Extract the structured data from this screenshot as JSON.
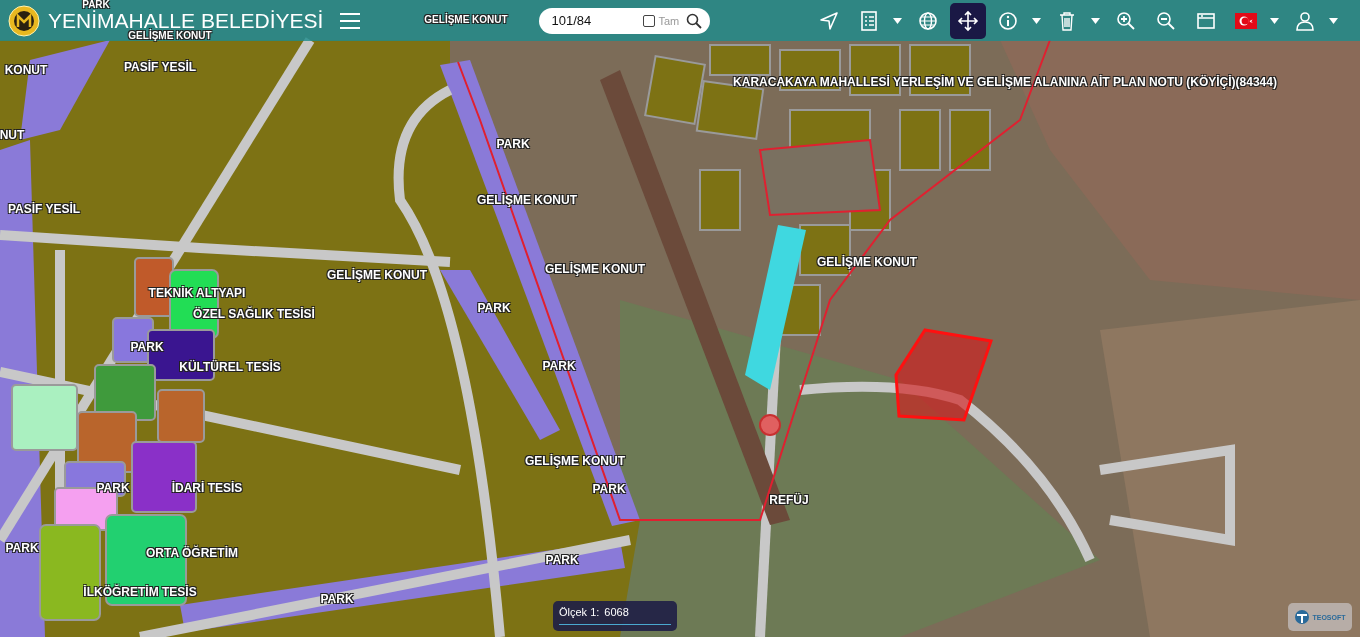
{
  "header": {
    "title": "YENİMAHALLE BELEDİYESİ"
  },
  "search": {
    "value": "101/84",
    "exact": {
      "label": "Tam",
      "checked": false
    }
  },
  "toolbar": [
    {
      "selected": false,
      "dropdown": false
    },
    {
      "selected": false,
      "dropdown": true
    },
    {
      "selected": false,
      "dropdown": false
    },
    {
      "selected": true,
      "dropdown": false
    },
    {
      "selected": false,
      "dropdown": true
    },
    {
      "selected": false,
      "dropdown": true
    },
    {
      "selected": false,
      "dropdown": false
    },
    {
      "selected": false,
      "dropdown": false
    },
    {
      "selected": false,
      "dropdown": false
    },
    {
      "selected": false,
      "dropdown": true
    },
    {
      "selected": false,
      "dropdown": true
    }
  ],
  "map_labels": [
    "PARK",
    "GELİŞME KONUT",
    "GELİŞME KONUT",
    "KONUT",
    "PASİF YESİL",
    "NUT",
    "PASİF YESİL",
    "PARK",
    "GELİŞME KONUT",
    "GELİŞME KONUT",
    "GELİŞME KONUT",
    "GELİŞME KONUT",
    "KARACAKAYA MAHALLESİ YERLEŞİM VE GELİŞME ALANINA AİT PLAN NOTU (KÖYİÇİ)(84344)",
    "TEKNİK ALTYAPI",
    "ÖZEL SAĞLIK TESİSİ",
    "PARK",
    "PARK",
    "KÜLTÜREL TESİS",
    "PARK",
    "GELİŞME KONUT",
    "PARK",
    "İDARİ TESİS",
    "PARK",
    "REFÜJ",
    "PARK",
    "ORTA ÖĞRETİM",
    "PARK",
    "İLKÖĞRETİM TESİS",
    "PARK"
  ],
  "scale": {
    "label": "Ölçek 1:",
    "value": "6068"
  },
  "brand": "TEOSOFT"
}
